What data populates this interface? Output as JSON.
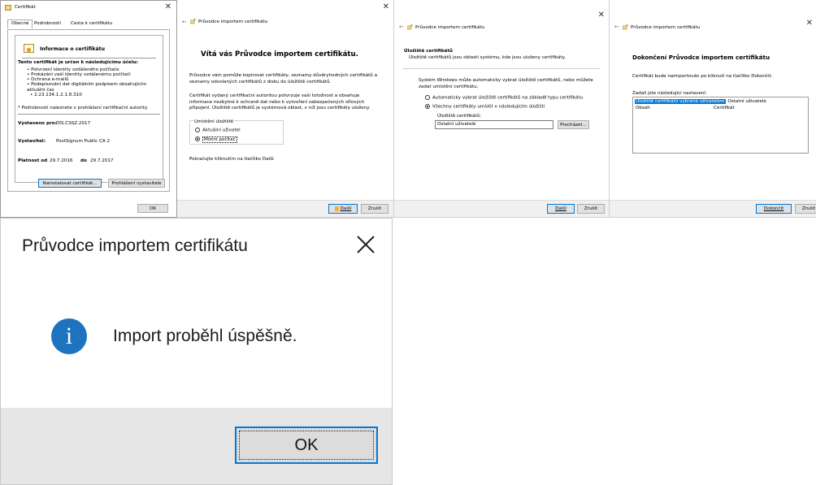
{
  "p1": {
    "title": "Certifikát",
    "tabs": [
      "Obecné",
      "Podrobnosti",
      "Cesta k certifikátu"
    ],
    "info_heading": "Informace o certifikátu",
    "purpose_heading": "Tento certifikát je určen k následujícímu účelu:",
    "purposes": [
      "• Potvrzení identity vzdáleného počítače",
      "• Prokázání vaší identity vzdálenému počítači",
      "• Ochrana e-mailů",
      "• Podepisování dat digitálním podpisem obsahujícím aktuální čas",
      "• 2.23.134.1.2.1.8.310"
    ],
    "details_note": "* Podrobnosti naleznete v prohlášení certifikační autority.",
    "issued_to_label": "Vystaveno pro:",
    "issued_to_value": "DIS.CSSZ.2017",
    "issuer_label": "Vystavitel:",
    "issuer_value": "PostSignum Public CA 2",
    "validity_from_label": "Platnost od",
    "validity_from": "29.7.2016",
    "validity_to_label": "do",
    "validity_to": "29.7.2017",
    "install_button": "Nainstalovat certifikát...",
    "issuer_statement_button": "Prohlášení vystavitele",
    "ok_button": "OK"
  },
  "p2": {
    "window_title": "Průvodce importem certifikátu",
    "heading": "Vítá vás Průvodce importem certifikátu.",
    "para1": "Průvodce vám pomůže kopírovat certifikáty, seznamy důvěryhodných certifikátů a seznamy odvolaných certifikátů z disku do úložiště certifikátů.",
    "para2": "Certifikát vydaný certifikační autoritou potvrzuje vaši totožnost a obsahuje informace nezbytné k ochraně dat nebo k vytvoření zabezpečených síťových připojení. Úložiště certifikátů je systémová oblast, v níž jsou certifikáty uloženy.",
    "group_label": "Umístění úložiště",
    "option_current_user": "Aktuální uživatel",
    "option_local_machine": "Místní počítač",
    "continue_text": "Pokračujte kliknutím na tlačítko Další.",
    "next_button": "Další",
    "cancel_button": "Zrušit"
  },
  "p3": {
    "window_title": "Průvodce importem certifikátu",
    "section_title": "Úložiště certifikátů",
    "section_desc": "Úložiště certifikátů jsou oblasti systému, kde jsou uloženy certifikáty.",
    "para": "Systém Windows může automaticky vybrat úložiště certifikátů, nebo můžete zadat umístění certifikátu.",
    "option_auto": "Automaticky vybrat úložiště certifikátů na základě typu certifikátu",
    "option_manual": "Všechny certifikáty umístit v následujícím úložišti",
    "store_label": "Úložiště certifikátů:",
    "store_value": "Ostatní uživatelé",
    "browse_button": "Procházet...",
    "next_button": "Další",
    "cancel_button": "Zrušit"
  },
  "p4": {
    "window_title": "Průvodce importem certifikátu",
    "heading": "Dokončení Průvodce importem certifikátu",
    "para": "Certifikát bude naimportován po kliknutí na tlačítko Dokončit.",
    "settings_label": "Zadali jste následující nastavení:",
    "rows": [
      {
        "key": "Úložiště certifikátů vybrané uživatelem",
        "value": "Ostatní uživatelé"
      },
      {
        "key": "Obsah",
        "value": "Certifikát"
      }
    ],
    "finish_button": "Dokončit",
    "cancel_button": "Zrušit"
  },
  "p5": {
    "title": "Průvodce importem certifikátu",
    "message": "Import proběhl úspěšně.",
    "ok_button": "OK",
    "info_icon_glyph": "i"
  },
  "colors": {
    "accent": "#0078d7",
    "info_icon": "#1e73be",
    "footer_bg": "#f0f0f0",
    "button_bg": "#e1e1e1",
    "highlight": "#0078d7"
  }
}
